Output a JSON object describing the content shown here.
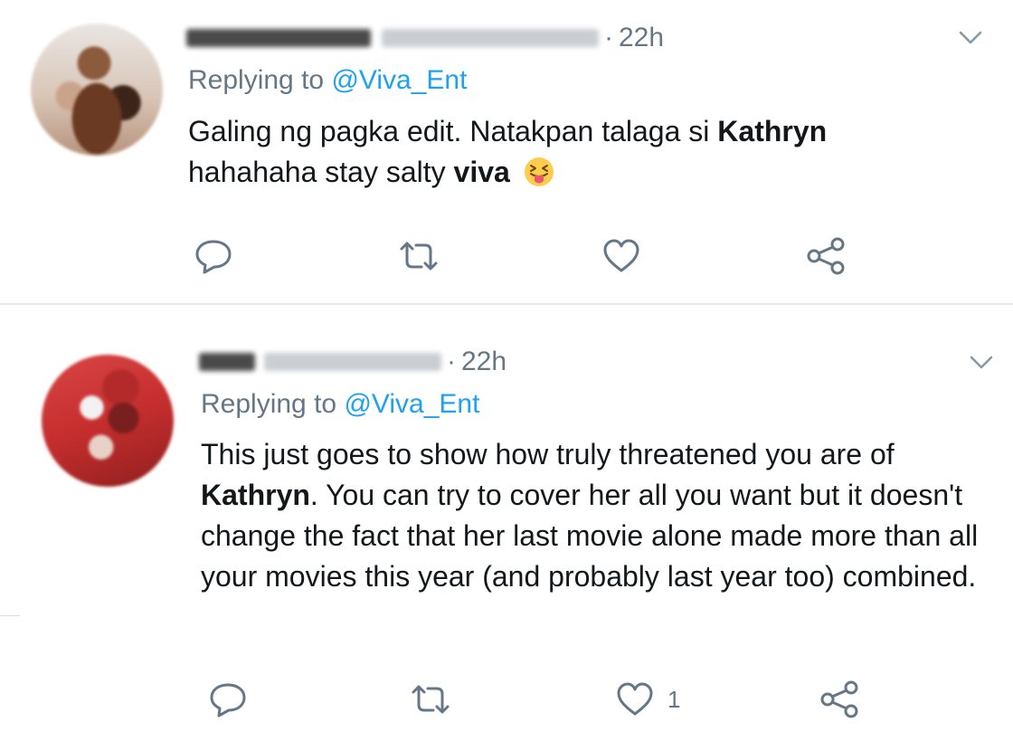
{
  "tweets": [
    {
      "time": "22h",
      "reply_prefix": "Replying to",
      "reply_handle": "@Viva_Ent",
      "body": {
        "part1": "Galing ng pagka edit. Natakpan talaga si ",
        "bold1": "Kathryn",
        "part2": "hahahaha stay salty ",
        "bold2": "viva",
        "emoji": "squinting-face-with-tongue"
      },
      "actions": {
        "reply_icon": "reply-icon",
        "retweet_icon": "retweet-icon",
        "like_icon": "heart-icon",
        "share_icon": "share-icon",
        "like_count": ""
      }
    },
    {
      "time": "22h",
      "reply_prefix": "Replying to",
      "reply_handle": "@Viva_Ent",
      "body": {
        "part1": "This just goes to show how truly threatened you are of ",
        "bold1": "Kathryn",
        "part2": ". You can try to cover her all you want but it doesn't change the fact that her last movie alone made more than all your movies this year (and probably last year too) combined."
      },
      "actions": {
        "reply_icon": "reply-icon",
        "retweet_icon": "retweet-icon",
        "like_icon": "heart-icon",
        "share_icon": "share-icon",
        "like_count": "1"
      }
    }
  ],
  "colors": {
    "text": "#14171a",
    "secondary": "#657786",
    "link": "#1da1f2",
    "divider": "#e1e8ed"
  }
}
